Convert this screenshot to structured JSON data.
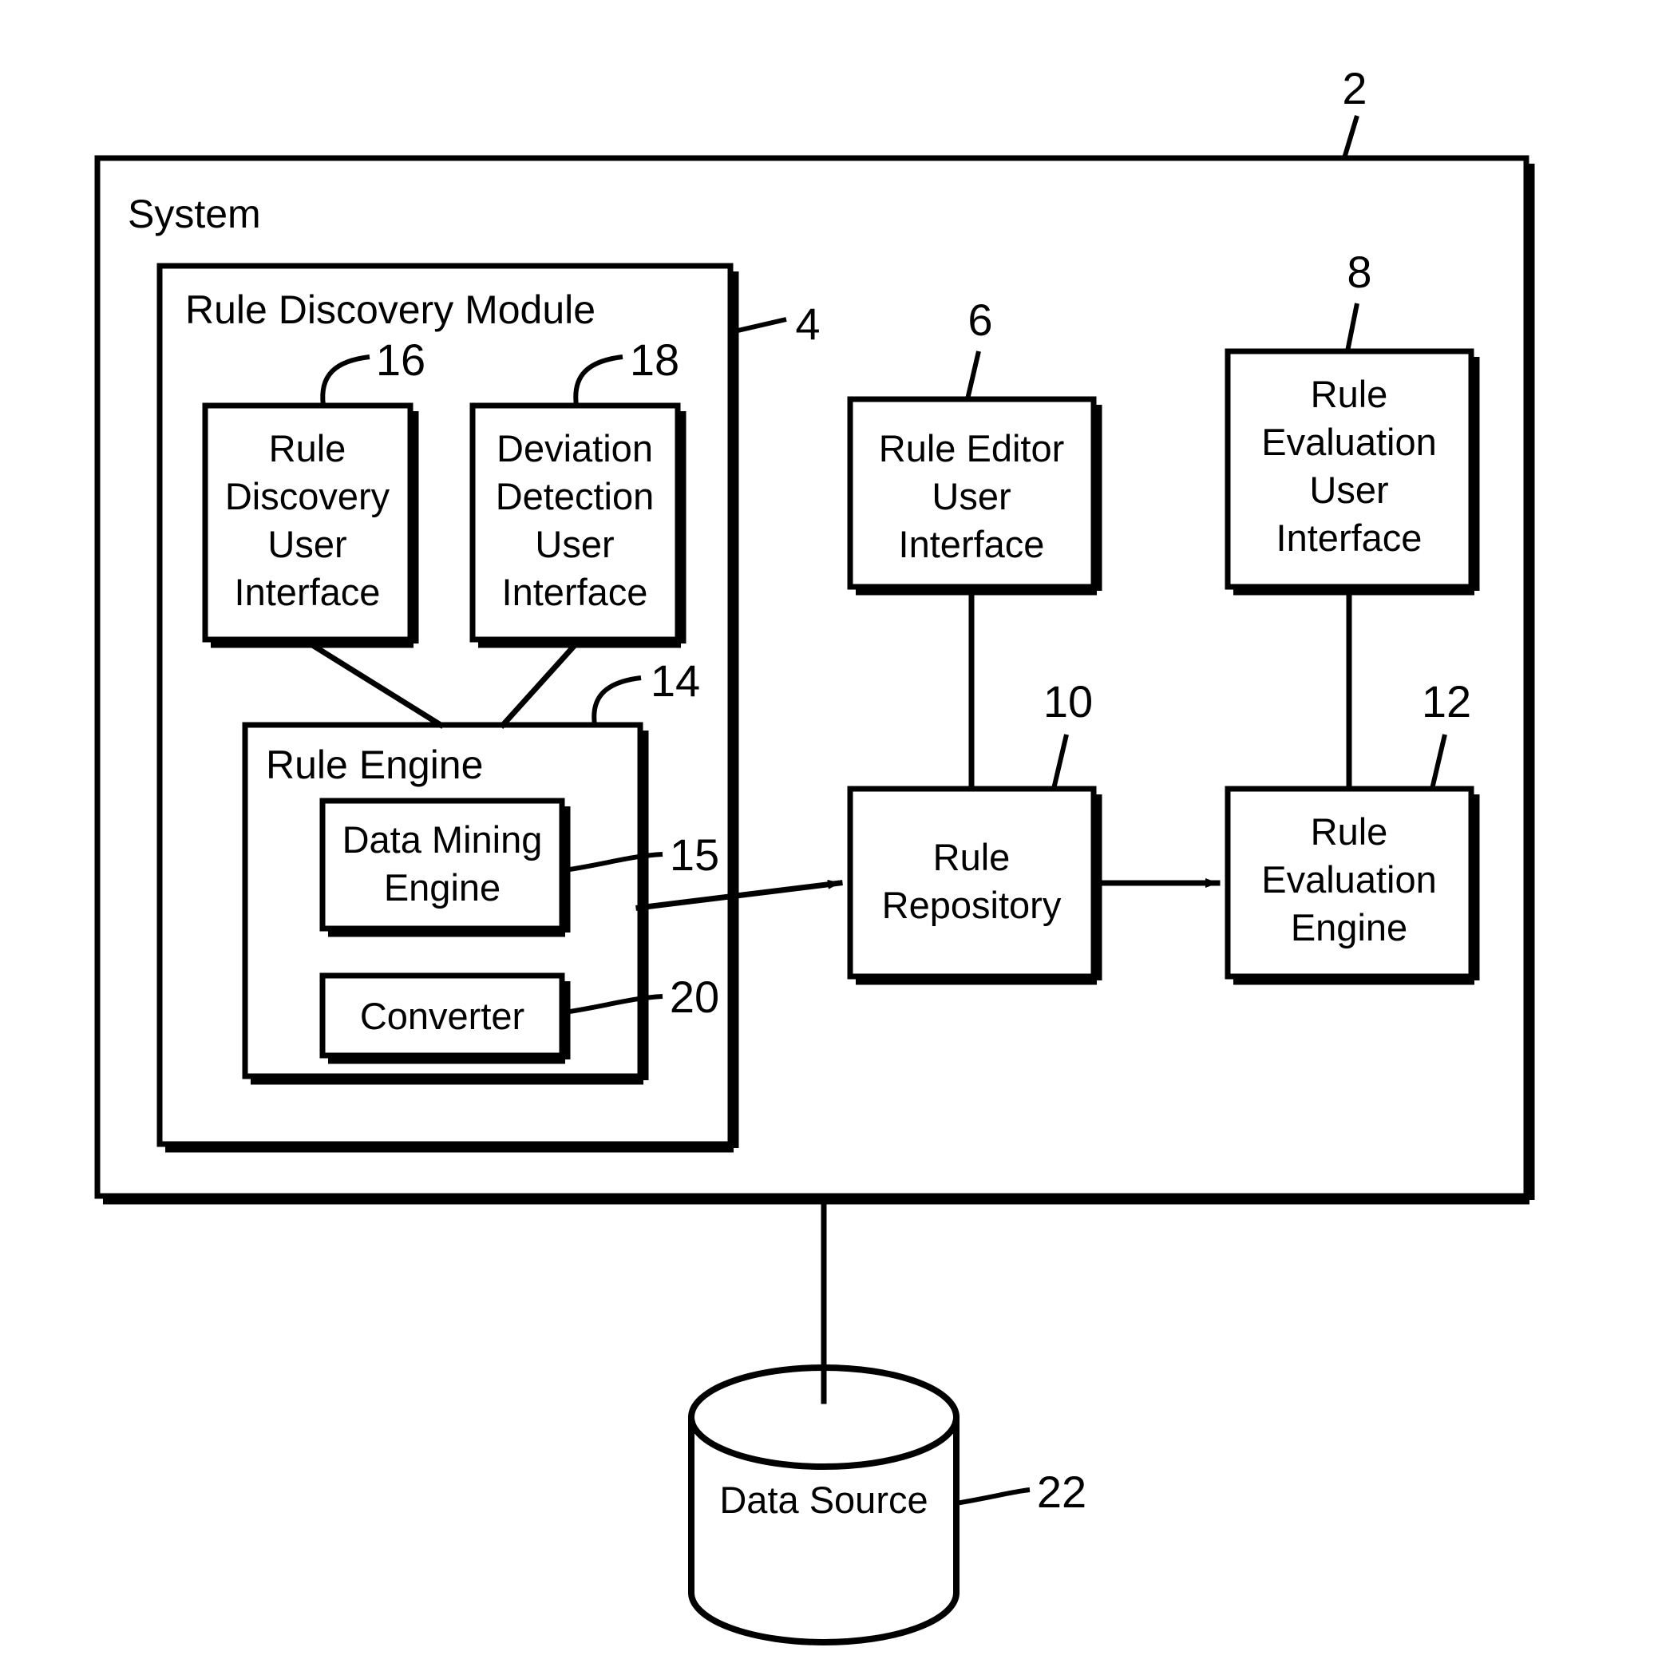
{
  "figure": {
    "type": "patent-block-diagram",
    "background_color": "#ffffff",
    "line_color": "#000000"
  },
  "containers": {
    "system": {
      "label": "System",
      "ref": "2"
    },
    "rule_discovery_module": {
      "label": "Rule Discovery Module",
      "ref": "4"
    },
    "rule_engine": {
      "label": "Rule Engine",
      "ref": "14"
    }
  },
  "blocks": {
    "rule_discovery_ui": {
      "lines": [
        "Rule",
        "Discovery",
        "User",
        "Interface"
      ],
      "ref": "16"
    },
    "deviation_detection_ui": {
      "lines": [
        "Deviation",
        "Detection",
        "User",
        "Interface"
      ],
      "ref": "18"
    },
    "data_mining_engine": {
      "lines": [
        "Data Mining",
        "Engine"
      ],
      "ref": "15"
    },
    "converter": {
      "lines": [
        "Converter"
      ],
      "ref": "20"
    },
    "rule_editor_ui": {
      "lines": [
        "Rule Editor",
        "User",
        "Interface"
      ],
      "ref": "6"
    },
    "rule_evaluation_ui": {
      "lines": [
        "Rule",
        "Evaluation",
        "User",
        "Interface"
      ],
      "ref": "8"
    },
    "rule_repository": {
      "lines": [
        "Rule",
        "Repository"
      ],
      "ref": "10"
    },
    "rule_evaluation_engine": {
      "lines": [
        "Rule",
        "Evaluation",
        "Engine"
      ],
      "ref": "12"
    },
    "data_source": {
      "lines": [
        "Data Source"
      ],
      "ref": "22"
    }
  },
  "reference_numerals": {
    "system": "2",
    "rule_discovery_module": "4",
    "rule_editor_ui": "6",
    "rule_evaluation_ui": "8",
    "rule_repository": "10",
    "rule_evaluation_engine": "12",
    "rule_engine": "14",
    "data_mining_engine": "15",
    "rule_discovery_ui": "16",
    "deviation_detection_ui": "18",
    "converter": "20",
    "data_source": "22"
  },
  "connections": [
    {
      "from": "rule_discovery_ui",
      "to": "rule_engine",
      "style": "plain-line"
    },
    {
      "from": "deviation_detection_ui",
      "to": "rule_engine",
      "style": "plain-line"
    },
    {
      "from": "rule_engine",
      "to": "rule_repository",
      "style": "arrow"
    },
    {
      "from": "rule_repository",
      "to": "rule_evaluation_engine",
      "style": "arrow"
    },
    {
      "from": "rule_editor_ui",
      "to": "rule_repository",
      "style": "plain-line"
    },
    {
      "from": "rule_evaluation_ui",
      "to": "rule_evaluation_engine",
      "style": "plain-line"
    },
    {
      "from": "system",
      "to": "data_source",
      "style": "plain-line"
    }
  ]
}
